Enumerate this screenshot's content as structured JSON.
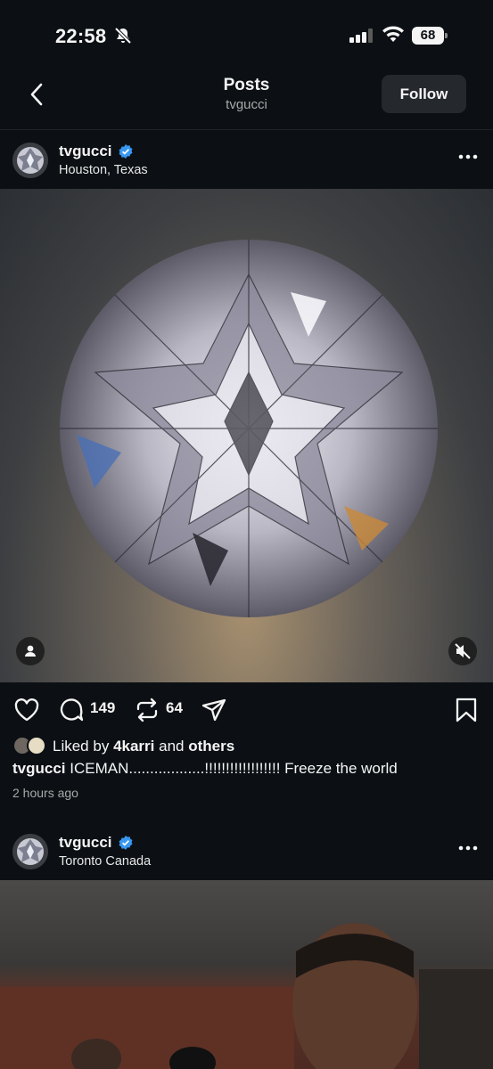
{
  "status_bar": {
    "time": "22:58",
    "battery": "68",
    "icons": [
      "bell-slash-icon",
      "cellular-signal-icon",
      "wifi-icon",
      "battery-icon"
    ]
  },
  "header": {
    "title": "Posts",
    "subtitle": "tvgucci",
    "follow_label": "Follow",
    "back_icon": "chevron-left-icon"
  },
  "posts": [
    {
      "username": "tvgucci",
      "location": "Houston, Texas",
      "verified": true,
      "media_icons": [
        "person-tag-icon",
        "speaker-muted-icon"
      ],
      "actions": {
        "comments": "149",
        "reposts": "64"
      },
      "liked_by": {
        "prefix": "Liked by",
        "user": "4karri",
        "middle": "and",
        "suffix": "others"
      },
      "caption": {
        "user": "tvgucci",
        "text": "ICEMAN..................!!!!!!!!!!!!!!!!!! Freeze the world"
      },
      "timestamp": "2 hours ago"
    },
    {
      "username": "tvgucci",
      "location": "Toronto Canada",
      "verified": true
    }
  ],
  "colors": {
    "background": "#0c1014",
    "verified": "#3897f0",
    "follow_button": "#25292e",
    "secondary_text": "#a8a8a8"
  }
}
